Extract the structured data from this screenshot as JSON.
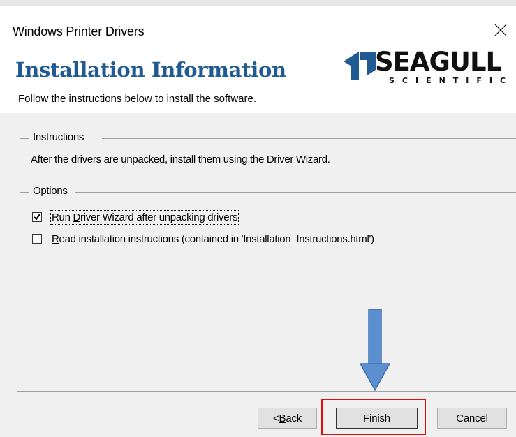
{
  "window": {
    "title": "Windows Printer Drivers"
  },
  "header": {
    "title": "Installation Information",
    "subtitle": "Follow the instructions below to install the software.",
    "logo_word": "SEAGULL",
    "logo_sub": "SCIENTIFIC"
  },
  "instructions": {
    "group_label": "Instructions",
    "text": "After the drivers are unpacked, install them using the Driver Wizard."
  },
  "options": {
    "group_label": "Options",
    "items": [
      {
        "label_pre": "Run ",
        "mnemonic": "D",
        "label_post": "river Wizard after unpacking drivers",
        "checked": true
      },
      {
        "label_pre": "",
        "mnemonic": "R",
        "label_post": "ead installation instructions (contained in 'Installation_Instructions.html')",
        "checked": false
      }
    ]
  },
  "buttons": {
    "back_pre": "< ",
    "back_mnemonic": "B",
    "back_post": "ack",
    "finish": "Finish",
    "cancel": "Cancel"
  },
  "annotation": {
    "arrow_color": "#5b8fd0",
    "highlight_color": "#e01010"
  }
}
